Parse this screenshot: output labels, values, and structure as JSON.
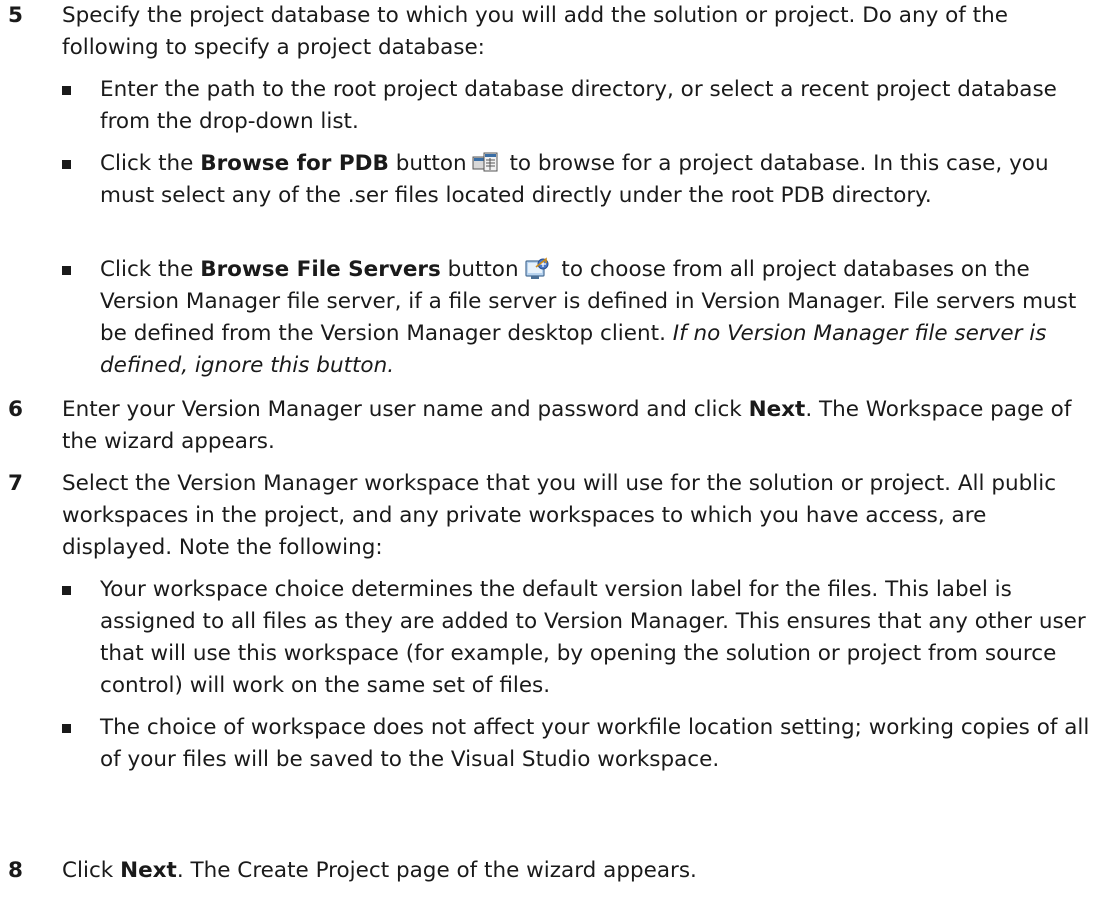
{
  "steps": {
    "s5": {
      "num": "5",
      "text": "Specify the project database to which you will add the solution or project. Do any of the following to specify a project database:",
      "bullets": {
        "b1": "Enter the path to the root project database directory, or select a recent project database from the drop-down list.",
        "b2": {
          "pre": "Click the ",
          "bold": "Browse for PDB",
          "mid": " button",
          "icon": "browse-pdb-icon",
          "post": " to browse for a project database. In this case, you must select any of the .ser files located directly under the root PDB directory."
        },
        "b3": {
          "pre": "Click the ",
          "bold": "Browse File Servers",
          "mid": " button",
          "icon": "browse-file-servers-icon",
          "post": " to choose from all project databases on the Version Manager file server, if a file server is defined in Version Manager. File servers must be defined from the Version Manager desktop client. ",
          "italic": "If no Version Manager file server is defined, ignore this button."
        }
      }
    },
    "s6": {
      "num": "6",
      "pre": "Enter your Version Manager user name and password and click ",
      "bold": "Next",
      "post": ". The Workspace page of the wizard appears."
    },
    "s7": {
      "num": "7",
      "text": "Select the Version Manager workspace that you will use for the solution or project. All public workspaces in the project, and any private workspaces to which you have access, are displayed. Note the following:",
      "bullets": {
        "b1": "Your workspace choice determines the default version label for the files. This label is assigned to all files as they are added to Version Manager. This ensures that any other user that will use this workspace (for example, by opening the solution or project from source control) will work on the same set of files.",
        "b2": "The choice of workspace does not affect your workfile location setting; working copies of all of your files will be saved to the Visual Studio workspace."
      }
    },
    "s8": {
      "num": "8",
      "pre": "Click ",
      "bold": "Next",
      "post": ". The Create Project page of the wizard appears."
    }
  }
}
